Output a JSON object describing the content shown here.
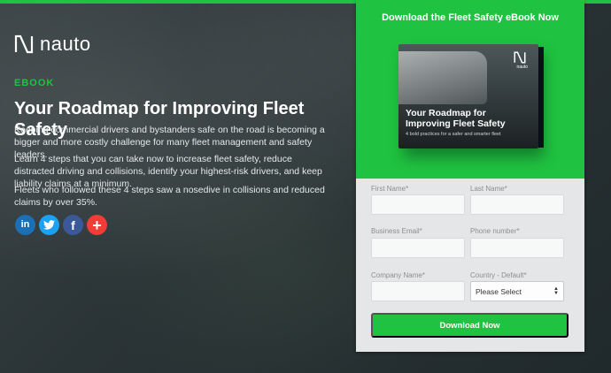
{
  "brand": {
    "name": "nauto"
  },
  "hero": {
    "eyebrow": "EBOOK",
    "title": "Your Roadmap for Improving Fleet Safety",
    "paragraphs": [
      "Keeping commercial drivers and bystanders safe on the road is becoming a bigger and more costly challenge for many fleet management and safety leaders.",
      "Learn 4 steps that you can take now to increase fleet safety, reduce distracted driving and collisions, identify your highest-risk drivers, and keep liability claims at a minimum.",
      "Fleets who followed these 4 steps saw a nosedive in collisions and reduced claims by over 35%."
    ]
  },
  "social": [
    {
      "label": "in",
      "icon": "linkedin-icon"
    },
    {
      "label": "t",
      "icon": "twitter-icon"
    },
    {
      "label": "f",
      "icon": "facebook-icon"
    },
    {
      "label": "+",
      "icon": "plus-icon"
    }
  ],
  "form": {
    "title": "Download the Fleet Safety eBook Now",
    "book": {
      "logo_text": "nauto",
      "title": "Your Roadmap for Improving Fleet Safety",
      "subtitle": "4 bold practices for a safer and smarter fleet"
    },
    "fields": {
      "first_name": "First Name*",
      "last_name": "Last Name*",
      "email": "Business Email*",
      "phone": "Phone number*",
      "company": "Company Name*",
      "country": "Country - Default*"
    },
    "country_selected": "Please Select",
    "submit_label": "Download Now"
  },
  "colors": {
    "accent": "#1fc241",
    "linkedin": "#1b6fb5",
    "twitter": "#1da1f2",
    "facebook": "#3b5998",
    "plus": "#f13c38"
  }
}
